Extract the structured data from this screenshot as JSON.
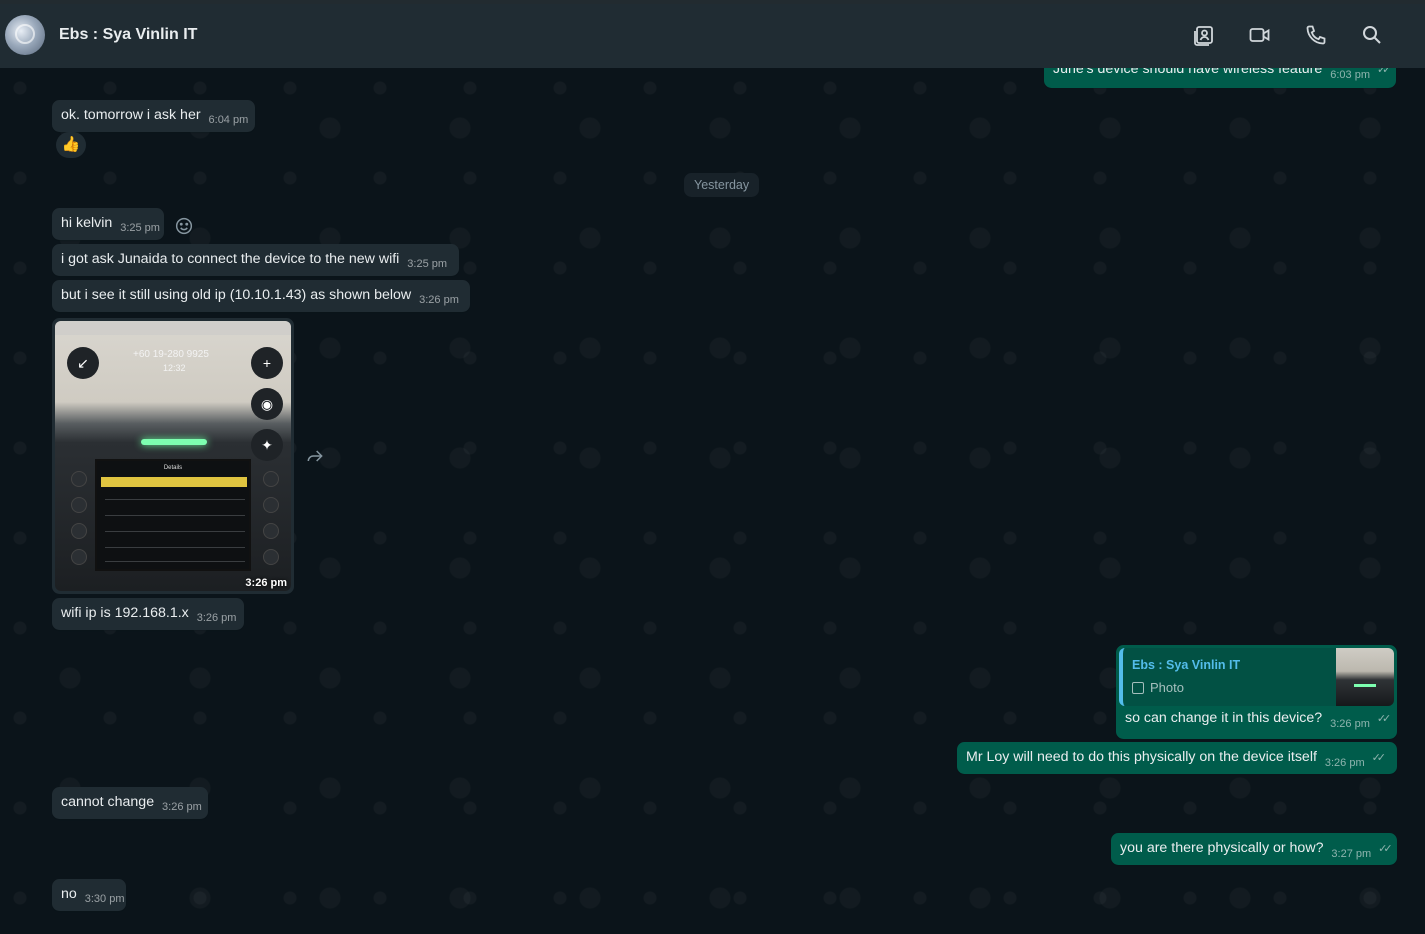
{
  "header": {
    "title": "Ebs : Sya Vinlin IT",
    "icons": [
      "contact-card-icon",
      "video-call-icon",
      "voice-call-icon",
      "search-icon"
    ]
  },
  "colors": {
    "header_bg": "#202c33",
    "incoming_bubble": "#202c33",
    "outgoing_bubble": "#005c4b",
    "chat_bg": "#0b141a",
    "reply_accent": "#53bdeb"
  },
  "messages": {
    "m0": {
      "text": "June's device should have wireless feature",
      "time": "6:03 pm"
    },
    "m1": {
      "text": "ok. tomorrow i ask her",
      "time": "6:04 pm",
      "reaction": "👍"
    },
    "date_divider": "Yesterday",
    "m2": {
      "text": "hi kelvin",
      "time": "3:25 pm"
    },
    "m3": {
      "text": "i got ask Junaida to connect the device to the new wifi",
      "time": "3:25 pm"
    },
    "m4": {
      "text": "but i see it still using old ip (10.10.1.43) as shown below",
      "time": "3:26 pm"
    },
    "photo": {
      "time": "3:26 pm",
      "phone_number": "+60 19-280 9925",
      "call_time": "12:32",
      "screen_title": "Details"
    },
    "m5": {
      "text": "wifi ip is 192.168.1.x",
      "time": "3:26 pm"
    },
    "m6": {
      "reply_name": "Ebs : Sya Vinlin IT",
      "reply_type": "Photo",
      "text": "so can change it in this device?",
      "time": "3:26 pm"
    },
    "m7": {
      "text": "Mr Loy will need to do this physically on the device itself",
      "time": "3:26 pm"
    },
    "m8": {
      "text": "cannot change",
      "time": "3:26 pm"
    },
    "m9": {
      "text": "you are there physically or how?",
      "time": "3:27 pm"
    },
    "m10": {
      "text": "no",
      "time": "3:30 pm"
    }
  }
}
